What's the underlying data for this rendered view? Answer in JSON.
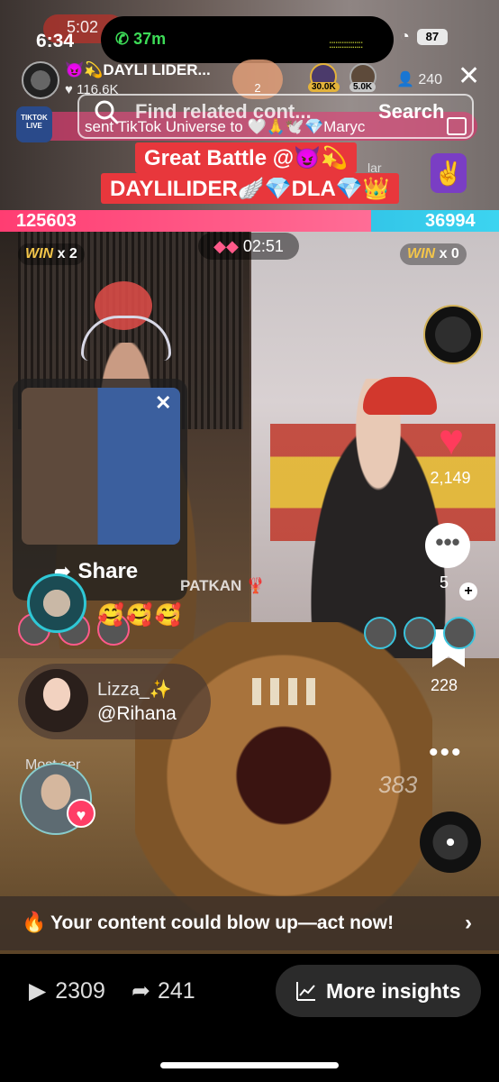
{
  "status_bar": {
    "time": "6:34",
    "call_duration": "37m",
    "battery": "87",
    "overlay_time": "5:02"
  },
  "live_header": {
    "host_name": "😈💫DAYLI LIDER...",
    "host_likes": "116.6K",
    "gift_count": "2",
    "viewer_badge_1": "30.0K",
    "viewer_badge_2": "5.0K",
    "viewer_count": "240",
    "close_label": "✕"
  },
  "search": {
    "placeholder": "Find related cont...",
    "button_label": "Search"
  },
  "ticker": {
    "tiktok_live_label": "TIKTOK LIVE",
    "text": "sent TikTok Universe to 🤍🙏🕊️💎Maryc"
  },
  "battle": {
    "title_line1": "Great Battle @😈💫",
    "title_line2": "DAYLILIDER🪽💎DLA💎👑",
    "side_text": "lar",
    "score_left": "125603",
    "score_right": "36994",
    "win_left_label": "WIN",
    "win_left_count": "x 2",
    "win_right_label": "WIN",
    "win_right_count": "x 0",
    "timer": "02:51"
  },
  "rail": {
    "like_count": "2,149",
    "comment_count": "5",
    "bookmark_count": "228",
    "more": "•••"
  },
  "share_popup": {
    "label": "Share",
    "close": "✕"
  },
  "overlays": {
    "emojis": "🥰🥰🥰",
    "patkan_text": "PATKAN 🦞",
    "user_name": "Lizza_✨",
    "user_handle": "@Rihana",
    "most_label": "Most ser",
    "ghost_number": "383"
  },
  "promo": {
    "text": "Your content could blow up—act now!"
  },
  "bottom": {
    "plays": "2309",
    "shares": "241",
    "insights_label": "More insights"
  },
  "colors": {
    "score_left": "#ff3d72",
    "score_right": "#33c6e8",
    "accent_red": "#e8373c",
    "like_red": "#ff3b5c"
  }
}
